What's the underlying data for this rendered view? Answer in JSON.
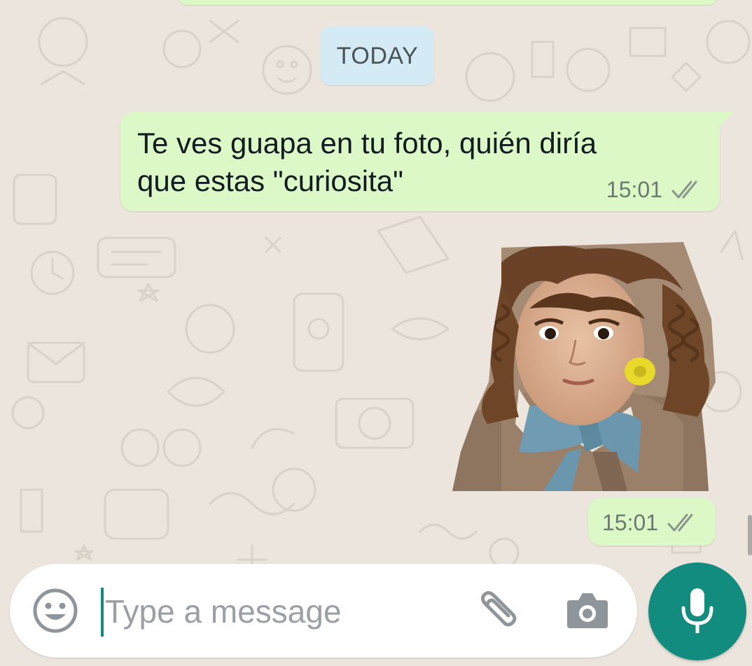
{
  "chat": {
    "date_divider": "TODAY",
    "messages": [
      {
        "type": "text",
        "lines": [
          "Te ves guapa en tu foto, quién diría",
          "que estas \"curiosita\""
        ],
        "time": "15:01",
        "status_icon": "double-check-icon"
      },
      {
        "type": "sticker",
        "sticker_description": "girl-with-bow-sticker",
        "time": "15:01",
        "status_icon": "double-check-icon"
      }
    ]
  },
  "composer": {
    "placeholder": "Type a message",
    "value": "",
    "icons": [
      "emoji-icon",
      "paperclip-icon",
      "camera-icon",
      "microphone-icon"
    ]
  },
  "colors": {
    "outgoing_bubble": "#dcf8c6",
    "date_chip": "#d4eaf4",
    "background": "#ece5dd",
    "accent": "#128c7e"
  }
}
